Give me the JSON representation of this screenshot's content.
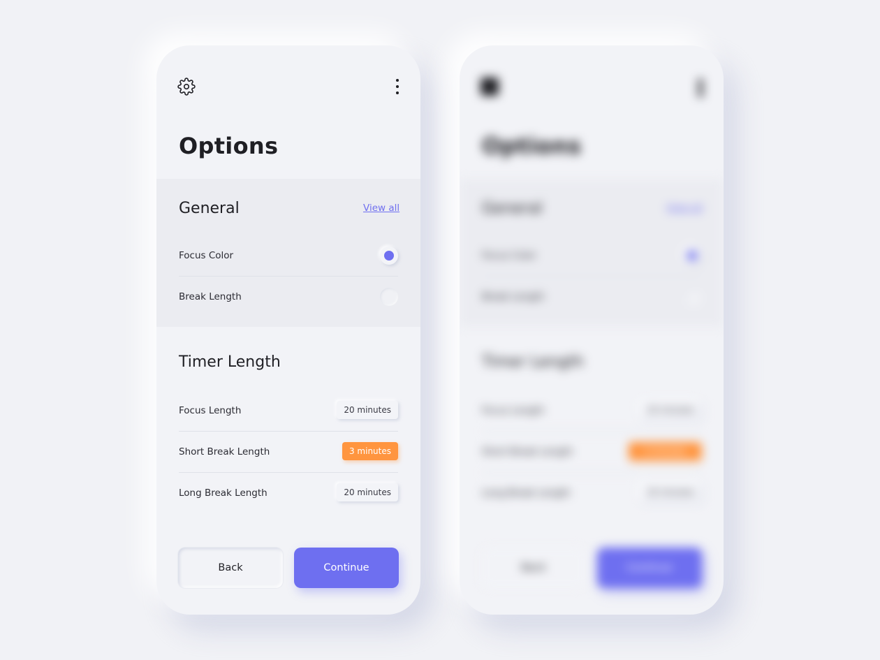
{
  "screen": {
    "title": "Options"
  },
  "general": {
    "title": "General",
    "view_all_label": "View all",
    "options": [
      {
        "label": "Focus Color",
        "selected": true
      },
      {
        "label": "Break Length",
        "selected": false
      }
    ]
  },
  "timer": {
    "title": "Timer Length",
    "rows": [
      {
        "label": "Focus Length",
        "value": "20 minutes",
        "highlighted": false
      },
      {
        "label": "Short Break Length",
        "value": "3 minutes",
        "highlighted": true
      },
      {
        "label": "Long Break Length",
        "value": "20 minutes",
        "highlighted": false
      }
    ]
  },
  "footer": {
    "back_label": "Back",
    "continue_label": "Continue"
  },
  "icons": {
    "settings": "gear-icon",
    "menu": "more-vertical-icon"
  },
  "colors": {
    "background": "#f1f2f6",
    "card": "#f2f3f7",
    "section_bg": "#ebecf1",
    "accent": "#6e6ff0",
    "highlight": "#ff953f",
    "text": "#1f1f24"
  }
}
